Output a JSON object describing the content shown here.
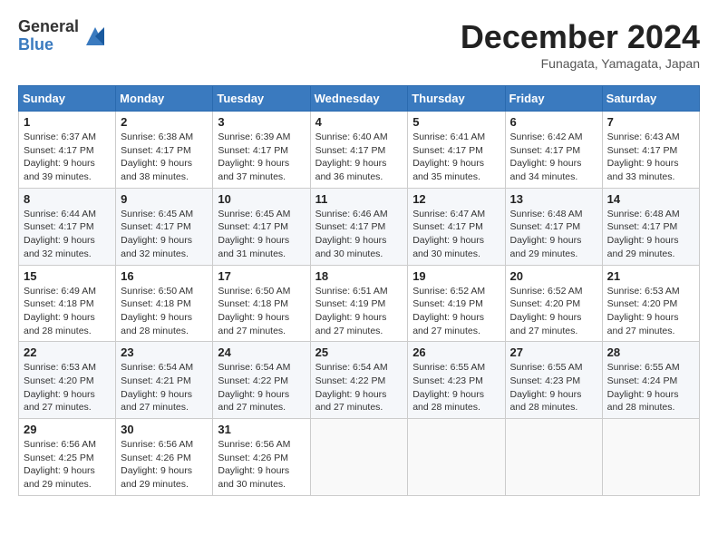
{
  "logo": {
    "general": "General",
    "blue": "Blue"
  },
  "header": {
    "month": "December 2024",
    "location": "Funagata, Yamagata, Japan"
  },
  "weekdays": [
    "Sunday",
    "Monday",
    "Tuesday",
    "Wednesday",
    "Thursday",
    "Friday",
    "Saturday"
  ],
  "weeks": [
    [
      {
        "day": "1",
        "info": "Sunrise: 6:37 AM\nSunset: 4:17 PM\nDaylight: 9 hours\nand 39 minutes."
      },
      {
        "day": "2",
        "info": "Sunrise: 6:38 AM\nSunset: 4:17 PM\nDaylight: 9 hours\nand 38 minutes."
      },
      {
        "day": "3",
        "info": "Sunrise: 6:39 AM\nSunset: 4:17 PM\nDaylight: 9 hours\nand 37 minutes."
      },
      {
        "day": "4",
        "info": "Sunrise: 6:40 AM\nSunset: 4:17 PM\nDaylight: 9 hours\nand 36 minutes."
      },
      {
        "day": "5",
        "info": "Sunrise: 6:41 AM\nSunset: 4:17 PM\nDaylight: 9 hours\nand 35 minutes."
      },
      {
        "day": "6",
        "info": "Sunrise: 6:42 AM\nSunset: 4:17 PM\nDaylight: 9 hours\nand 34 minutes."
      },
      {
        "day": "7",
        "info": "Sunrise: 6:43 AM\nSunset: 4:17 PM\nDaylight: 9 hours\nand 33 minutes."
      }
    ],
    [
      {
        "day": "8",
        "info": "Sunrise: 6:44 AM\nSunset: 4:17 PM\nDaylight: 9 hours\nand 32 minutes."
      },
      {
        "day": "9",
        "info": "Sunrise: 6:45 AM\nSunset: 4:17 PM\nDaylight: 9 hours\nand 32 minutes."
      },
      {
        "day": "10",
        "info": "Sunrise: 6:45 AM\nSunset: 4:17 PM\nDaylight: 9 hours\nand 31 minutes."
      },
      {
        "day": "11",
        "info": "Sunrise: 6:46 AM\nSunset: 4:17 PM\nDaylight: 9 hours\nand 30 minutes."
      },
      {
        "day": "12",
        "info": "Sunrise: 6:47 AM\nSunset: 4:17 PM\nDaylight: 9 hours\nand 30 minutes."
      },
      {
        "day": "13",
        "info": "Sunrise: 6:48 AM\nSunset: 4:17 PM\nDaylight: 9 hours\nand 29 minutes."
      },
      {
        "day": "14",
        "info": "Sunrise: 6:48 AM\nSunset: 4:17 PM\nDaylight: 9 hours\nand 29 minutes."
      }
    ],
    [
      {
        "day": "15",
        "info": "Sunrise: 6:49 AM\nSunset: 4:18 PM\nDaylight: 9 hours\nand 28 minutes."
      },
      {
        "day": "16",
        "info": "Sunrise: 6:50 AM\nSunset: 4:18 PM\nDaylight: 9 hours\nand 28 minutes."
      },
      {
        "day": "17",
        "info": "Sunrise: 6:50 AM\nSunset: 4:18 PM\nDaylight: 9 hours\nand 27 minutes."
      },
      {
        "day": "18",
        "info": "Sunrise: 6:51 AM\nSunset: 4:19 PM\nDaylight: 9 hours\nand 27 minutes."
      },
      {
        "day": "19",
        "info": "Sunrise: 6:52 AM\nSunset: 4:19 PM\nDaylight: 9 hours\nand 27 minutes."
      },
      {
        "day": "20",
        "info": "Sunrise: 6:52 AM\nSunset: 4:20 PM\nDaylight: 9 hours\nand 27 minutes."
      },
      {
        "day": "21",
        "info": "Sunrise: 6:53 AM\nSunset: 4:20 PM\nDaylight: 9 hours\nand 27 minutes."
      }
    ],
    [
      {
        "day": "22",
        "info": "Sunrise: 6:53 AM\nSunset: 4:20 PM\nDaylight: 9 hours\nand 27 minutes."
      },
      {
        "day": "23",
        "info": "Sunrise: 6:54 AM\nSunset: 4:21 PM\nDaylight: 9 hours\nand 27 minutes."
      },
      {
        "day": "24",
        "info": "Sunrise: 6:54 AM\nSunset: 4:22 PM\nDaylight: 9 hours\nand 27 minutes."
      },
      {
        "day": "25",
        "info": "Sunrise: 6:54 AM\nSunset: 4:22 PM\nDaylight: 9 hours\nand 27 minutes."
      },
      {
        "day": "26",
        "info": "Sunrise: 6:55 AM\nSunset: 4:23 PM\nDaylight: 9 hours\nand 28 minutes."
      },
      {
        "day": "27",
        "info": "Sunrise: 6:55 AM\nSunset: 4:23 PM\nDaylight: 9 hours\nand 28 minutes."
      },
      {
        "day": "28",
        "info": "Sunrise: 6:55 AM\nSunset: 4:24 PM\nDaylight: 9 hours\nand 28 minutes."
      }
    ],
    [
      {
        "day": "29",
        "info": "Sunrise: 6:56 AM\nSunset: 4:25 PM\nDaylight: 9 hours\nand 29 minutes."
      },
      {
        "day": "30",
        "info": "Sunrise: 6:56 AM\nSunset: 4:26 PM\nDaylight: 9 hours\nand 29 minutes."
      },
      {
        "day": "31",
        "info": "Sunrise: 6:56 AM\nSunset: 4:26 PM\nDaylight: 9 hours\nand 30 minutes."
      },
      null,
      null,
      null,
      null
    ]
  ]
}
